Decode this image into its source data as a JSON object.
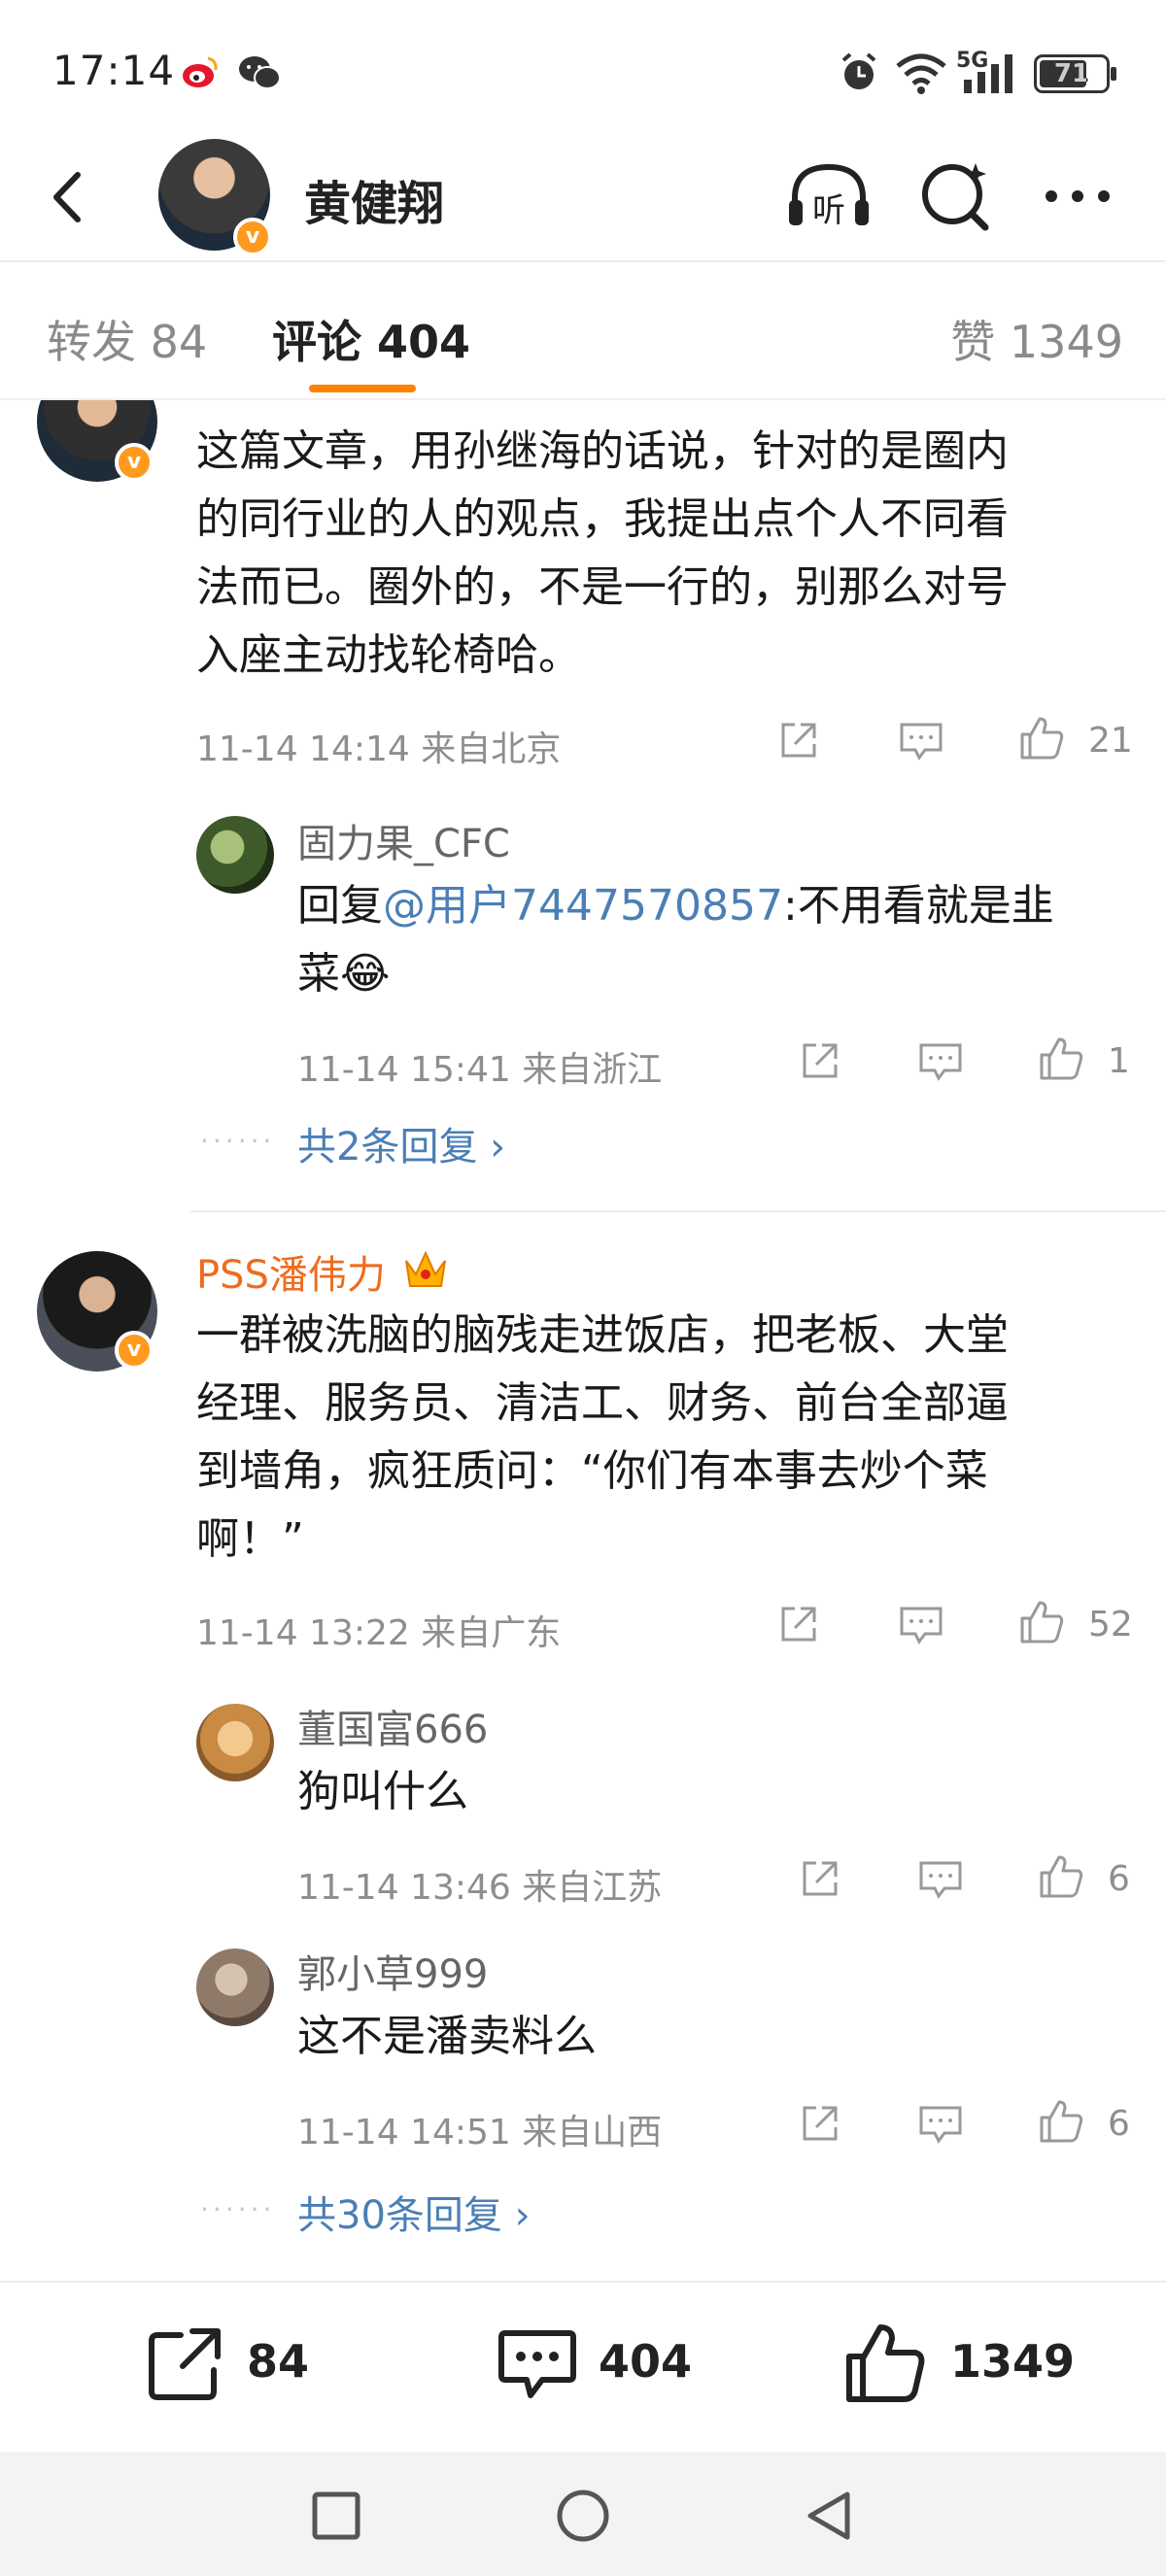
{
  "status": {
    "time": "17:14",
    "network": "5G",
    "battery": "71",
    "icons": [
      "weibo-icon",
      "wechat-icon",
      "alarm-icon",
      "wifi-icon",
      "signal-icon",
      "battery-icon"
    ]
  },
  "header": {
    "title": "黄健翔",
    "back_icon": "back-arrow-icon",
    "listen_icon": "headphones-listen-icon",
    "listen_glyph": "听",
    "search_icon": "search-icon",
    "more_icon": "more-dots-icon"
  },
  "tabs": [
    {
      "label": "转发 84"
    },
    {
      "label": "评论 404"
    },
    {
      "label": "赞 1349"
    }
  ],
  "comments": [
    {
      "author": "",
      "text": [
        "这篇文章，用孙继海的话说，针对的是圈内",
        "的同行业的人的观点，我提出点个人不同看",
        "法而已。圈外的，不是一行的，别那么对号",
        "入座主动找轮椅哈。"
      ],
      "meta": "11-14 14:14  来自北京",
      "likes": "21",
      "replies": [
        {
          "author": "固力果_CFC",
          "prefix": "回复",
          "mention": "@用户7447570857",
          "text_line1": ":不用看就是韭",
          "text_line2": "菜😂",
          "meta": "11-14 15:41  来自浙江",
          "likes": "1"
        }
      ],
      "more_replies": "共2条回复 ›"
    },
    {
      "author": "PSS潘伟力",
      "crown_icon": "crown-icon",
      "text": [
        "一群被洗脑的脑残走进饭店，把老板、大堂",
        "经理、服务员、清洁工、财务、前台全部逼",
        "到墙角，疯狂质问：“你们有本事去炒个菜",
        "啊！”"
      ],
      "meta": "11-14 13:22  来自广东",
      "likes": "52",
      "replies": [
        {
          "author": "董国富666",
          "text": "狗叫什么",
          "meta": "11-14 13:46  来自江苏",
          "likes": "6"
        },
        {
          "author": "郭小草999",
          "text": "这不是潘卖料么",
          "meta": "11-14 14:51  来自山西",
          "likes": "6"
        }
      ],
      "more_replies": "共30条回复 ›"
    }
  ],
  "actionbar": {
    "repost_count": "84",
    "comment_count": "404",
    "like_count": "1349"
  },
  "colors": {
    "accent": "#ff8200",
    "link": "#4a7fb5",
    "vip_name": "#f06b1d",
    "meta": "#8e8e8e"
  }
}
